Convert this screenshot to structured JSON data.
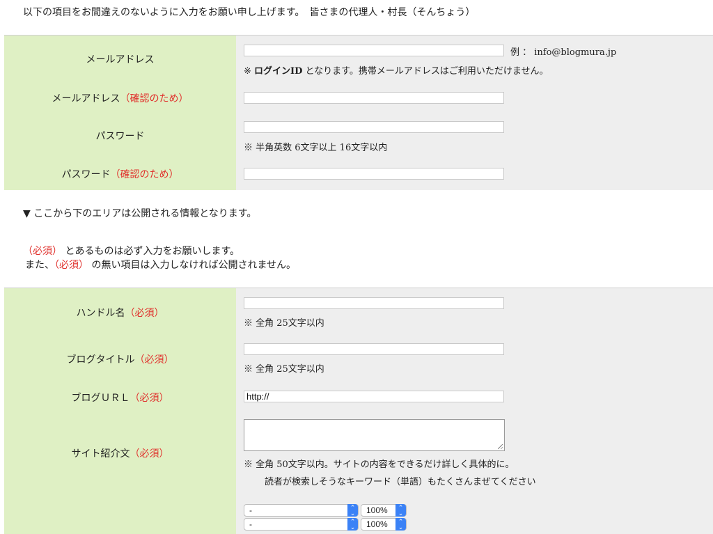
{
  "intro": "以下の項目をお間違えのないように入力をお願い申し上げます。　皆さまの代理人・村長（そんちょう）",
  "account": {
    "email_label": "メールアドレス",
    "email_confirm_label": "メールアドレス",
    "confirm_suffix": "（確認のため）",
    "password_label": "パスワード",
    "password_confirm_label": "パスワード",
    "email_example": "例 ： info@blogmura.jp",
    "email_note_prefix": "※ ",
    "email_note_bold": "ログインID",
    "email_note_rest": " となります。携帯メールアドレスはご利用いただけません。",
    "password_note": "※ 半角英数 6文字以上 16文字以内"
  },
  "public_notice": {
    "heading": "▼ ここから下のエリアは公開される情報となります。",
    "required_tag": "（必須）",
    "line1_rest": " とあるものは必ず入力をお願いします。",
    "line2_prefix": "また、",
    "line2_rest": " の無い項目は入力しなければ公開されません。"
  },
  "profile": {
    "handle_label": "ハンドル名",
    "blog_title_label": "ブログタイトル",
    "blog_url_label": "ブログＵＲＬ",
    "site_intro_label": "サイト紹介文",
    "required_tag": "（必須）",
    "handle_note": "※ 全角 25文字以内",
    "title_note": "※ 全角 25文字以内",
    "url_value": "http://",
    "intro_note1": "※ 全角 50文字以内。サイトの内容をできるだけ詳しく具体的に。",
    "intro_note2": "読者が検索しそうなキーワード（単語）もたくさんまぜてください"
  },
  "selects": [
    {
      "category": "-",
      "percent": "100%"
    },
    {
      "category": "-",
      "percent": "100%"
    }
  ],
  "colors": {
    "label_bg": "#dff0c4",
    "field_bg": "#eeeeee",
    "required": "#e0302c",
    "select_accent": "#3b82f6"
  }
}
